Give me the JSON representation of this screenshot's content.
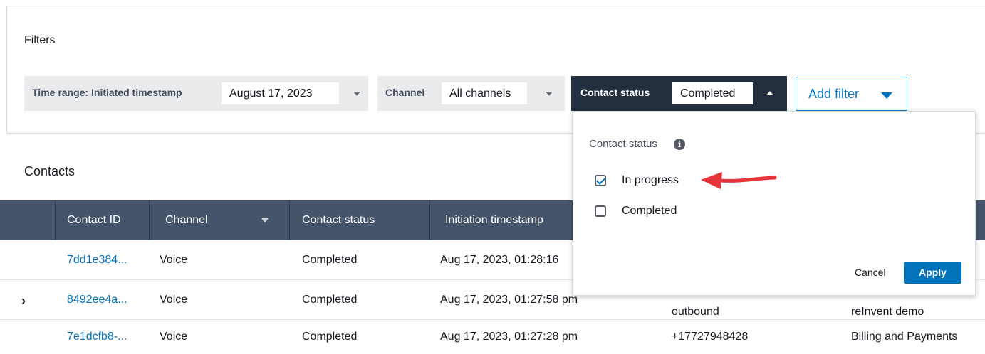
{
  "filters": {
    "title": "Filters",
    "time_range": {
      "label": "Time range:",
      "sublabel": "Initiated timestamp",
      "value": "August 17, 2023"
    },
    "channel": {
      "label": "Channel",
      "value": "All channels"
    },
    "contact_status": {
      "label": "Contact status",
      "value": "Completed"
    },
    "add_filter_label": "Add filter"
  },
  "popover": {
    "title": "Contact status",
    "info_icon": "info-icon",
    "options": [
      {
        "label": "In progress",
        "checked": true
      },
      {
        "label": "Completed",
        "checked": false
      }
    ],
    "cancel_label": "Cancel",
    "apply_label": "Apply"
  },
  "contacts": {
    "title": "Contacts",
    "columns": [
      "Contact ID",
      "Channel",
      "Contact status",
      "Initiation timestamp"
    ],
    "rows": [
      {
        "id": "7dd1e384...",
        "channel": "Voice",
        "status": "Completed",
        "timestamp": "Aug 17, 2023, 01:28:16",
        "col5": "",
        "col6": ""
      },
      {
        "id": "8492ee4a...",
        "channel": "Voice",
        "status": "Completed",
        "timestamp": "Aug 17, 2023, 01:27:58 pm",
        "col5": "outbound",
        "col6": "reInvent demo"
      },
      {
        "id": "7e1dcfb8-...",
        "channel": "Voice",
        "status": "Completed",
        "timestamp": "Aug 17, 2023, 01:27:28 pm",
        "col5": "+17727948428",
        "col6": "Billing and Payments"
      }
    ]
  },
  "colors": {
    "header_bg": "#44546a",
    "active_chip_bg": "#232f3e",
    "link": "#0073bb",
    "apply_bg": "#0073bb",
    "annotation_arrow": "#e8353b"
  }
}
